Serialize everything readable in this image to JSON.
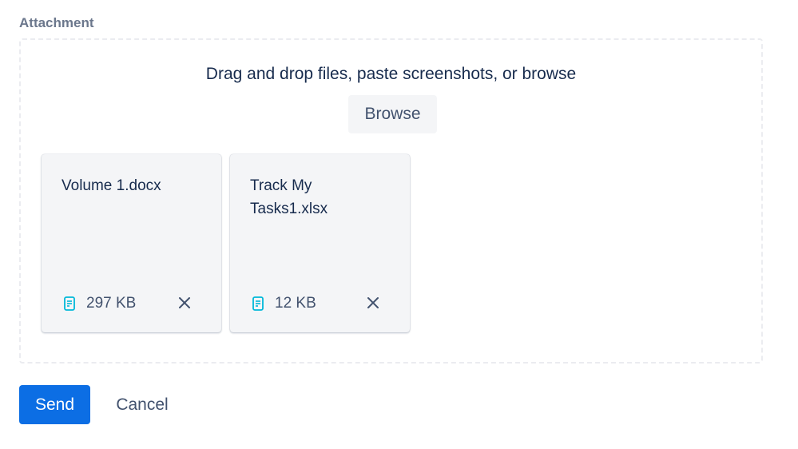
{
  "attachment": {
    "label": "Attachment",
    "dropzone_text": "Drag and drop files, paste screenshots, or browse",
    "browse_label": "Browse",
    "files": [
      {
        "name": "Volume 1.docx",
        "size": "297 KB",
        "icon": "document-icon"
      },
      {
        "name": "Track My Tasks1.xlsx",
        "size": "12 KB",
        "icon": "document-icon"
      }
    ],
    "remove_icon": "close-icon"
  },
  "actions": {
    "send_label": "Send",
    "cancel_label": "Cancel"
  },
  "colors": {
    "primary": "#0c6ee4",
    "file_icon": "#00b8d9",
    "card_bg": "#f4f5f7",
    "dropzone_border": "#ebecf0"
  }
}
